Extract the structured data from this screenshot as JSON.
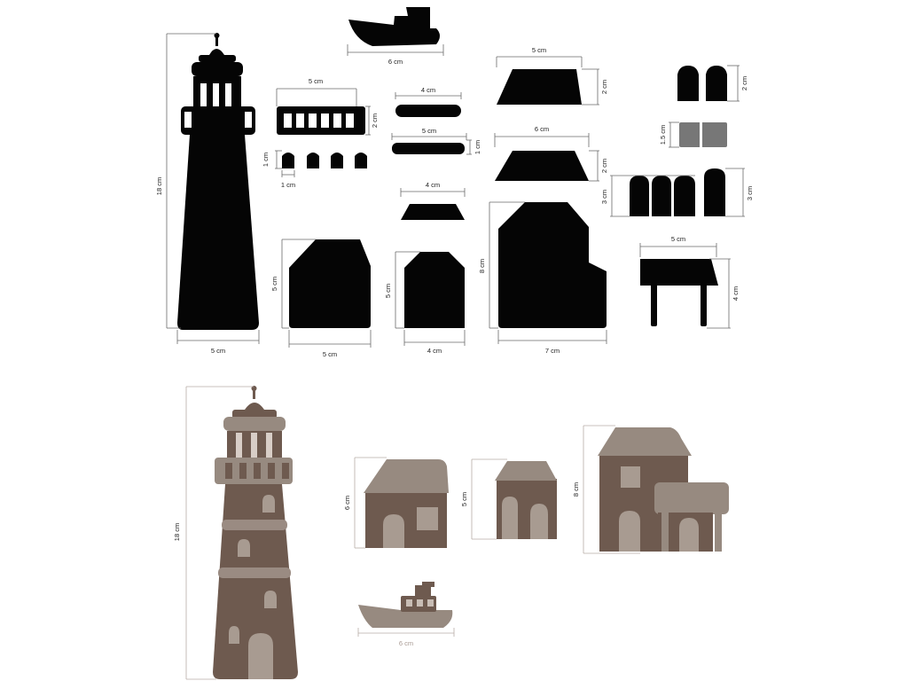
{
  "labels": {
    "lighthouse_height": "18 cm",
    "lighthouse_width": "5 cm",
    "boat_width": "6 cm",
    "railing_width": "5 cm",
    "railing_height": "2 cm",
    "windows_height": "1 cm",
    "windows_width": "1 cm",
    "bar_long_width": "4 cm",
    "bar_short_width": "5 cm",
    "bar_short_height": "1 cm",
    "roof_small_width": "4 cm",
    "house_a_height": "5 cm",
    "house_a_width": "5 cm",
    "house_b_height": "5 cm",
    "house_b_width": "4 cm",
    "roof_big_width": "5 cm",
    "roof_big_height": "2 cm",
    "roof_mid_width": "6 cm",
    "roof_mid_height": "2 cm",
    "house_c_height": "8 cm",
    "house_c_width": "7 cm",
    "arch_small_height": "2 cm",
    "grey_piece_height": "1.5 cm",
    "doors_height": "3 cm",
    "door_single_height": "3 cm",
    "table_width": "5 cm",
    "table_height": "4 cm",
    "preview_lighthouse_height": "18 cm",
    "preview_house1_height": "6 cm",
    "preview_house2_height": "5 cm",
    "preview_house3_height": "8 cm",
    "preview_boat_width": "6 cm"
  },
  "colors": {
    "cutout": "#050505",
    "grey_piece": "#777777",
    "wall": "#6e5a4f",
    "roof": "#978a80",
    "highlight": "#a09287"
  }
}
